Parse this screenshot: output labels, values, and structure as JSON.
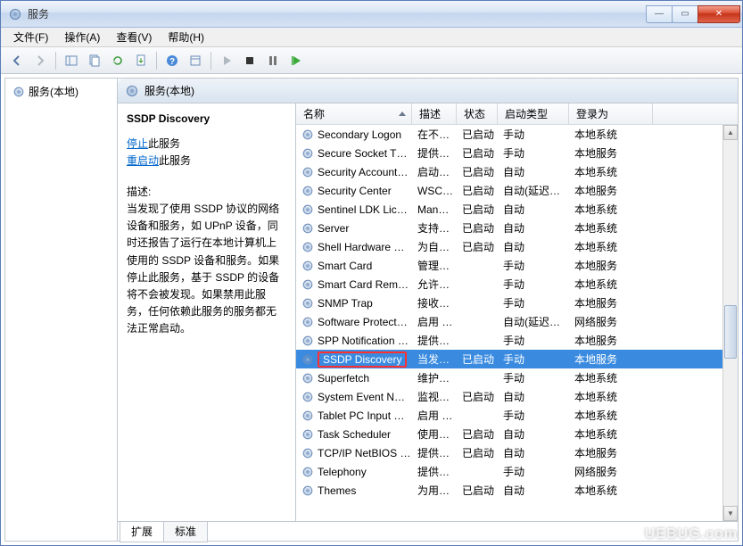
{
  "window": {
    "title": "服务"
  },
  "menu": {
    "file": "文件(F)",
    "action": "操作(A)",
    "view": "查看(V)",
    "help": "帮助(H)"
  },
  "tree": {
    "root": "服务(本地)"
  },
  "panel": {
    "header": "服务(本地)"
  },
  "details": {
    "name": "SSDP Discovery",
    "stop_link": "停止",
    "stop_rest": "此服务",
    "restart_link": "重启动",
    "restart_rest": "此服务",
    "desc_label": "描述:",
    "desc_text": "当发现了使用 SSDP 协议的网络设备和服务，如 UPnP 设备，同时还报告了运行在本地计算机上使用的 SSDP 设备和服务。如果停止此服务，基于 SSDP 的设备将不会被发现。如果禁用此服务，任何依赖此服务的服务都无法正常启动。"
  },
  "columns": {
    "name": "名称",
    "desc": "描述",
    "status": "状态",
    "startup": "启动类型",
    "logon": "登录为"
  },
  "tabs": {
    "extended": "扩展",
    "standard": "标准"
  },
  "services": [
    {
      "name": "Secondary Logon",
      "desc": "在不…",
      "status": "已启动",
      "startup": "手动",
      "logon": "本地系统"
    },
    {
      "name": "Secure Socket T…",
      "desc": "提供…",
      "status": "已启动",
      "startup": "手动",
      "logon": "本地服务"
    },
    {
      "name": "Security Account…",
      "desc": "启动…",
      "status": "已启动",
      "startup": "自动",
      "logon": "本地系统"
    },
    {
      "name": "Security Center",
      "desc": "WSC…",
      "status": "已启动",
      "startup": "自动(延迟…",
      "logon": "本地服务"
    },
    {
      "name": "Sentinel LDK Lic…",
      "desc": "Man…",
      "status": "已启动",
      "startup": "自动",
      "logon": "本地系统"
    },
    {
      "name": "Server",
      "desc": "支持…",
      "status": "已启动",
      "startup": "自动",
      "logon": "本地系统"
    },
    {
      "name": "Shell Hardware …",
      "desc": "为自…",
      "status": "已启动",
      "startup": "自动",
      "logon": "本地系统"
    },
    {
      "name": "Smart Card",
      "desc": "管理…",
      "status": "",
      "startup": "手动",
      "logon": "本地服务"
    },
    {
      "name": "Smart Card Rem…",
      "desc": "允许…",
      "status": "",
      "startup": "手动",
      "logon": "本地系统"
    },
    {
      "name": "SNMP Trap",
      "desc": "接收…",
      "status": "",
      "startup": "手动",
      "logon": "本地服务"
    },
    {
      "name": "Software Protect…",
      "desc": "启用 …",
      "status": "",
      "startup": "自动(延迟…",
      "logon": "网络服务"
    },
    {
      "name": "SPP Notification …",
      "desc": "提供…",
      "status": "",
      "startup": "手动",
      "logon": "本地服务"
    },
    {
      "name": "SSDP Discovery",
      "desc": "当发…",
      "status": "已启动",
      "startup": "手动",
      "logon": "本地服务",
      "selected": true,
      "highlighted": true
    },
    {
      "name": "Superfetch",
      "desc": "维护…",
      "status": "",
      "startup": "手动",
      "logon": "本地系统"
    },
    {
      "name": "System Event N…",
      "desc": "监视…",
      "status": "已启动",
      "startup": "自动",
      "logon": "本地系统"
    },
    {
      "name": "Tablet PC Input …",
      "desc": "启用 …",
      "status": "",
      "startup": "手动",
      "logon": "本地系统"
    },
    {
      "name": "Task Scheduler",
      "desc": "使用…",
      "status": "已启动",
      "startup": "自动",
      "logon": "本地系统"
    },
    {
      "name": "TCP/IP NetBIOS …",
      "desc": "提供…",
      "status": "已启动",
      "startup": "自动",
      "logon": "本地服务"
    },
    {
      "name": "Telephony",
      "desc": "提供…",
      "status": "",
      "startup": "手动",
      "logon": "网络服务"
    },
    {
      "name": "Themes",
      "desc": "为用…",
      "status": "已启动",
      "startup": "自动",
      "logon": "本地系统"
    }
  ],
  "watermark": "UEBUG.com"
}
